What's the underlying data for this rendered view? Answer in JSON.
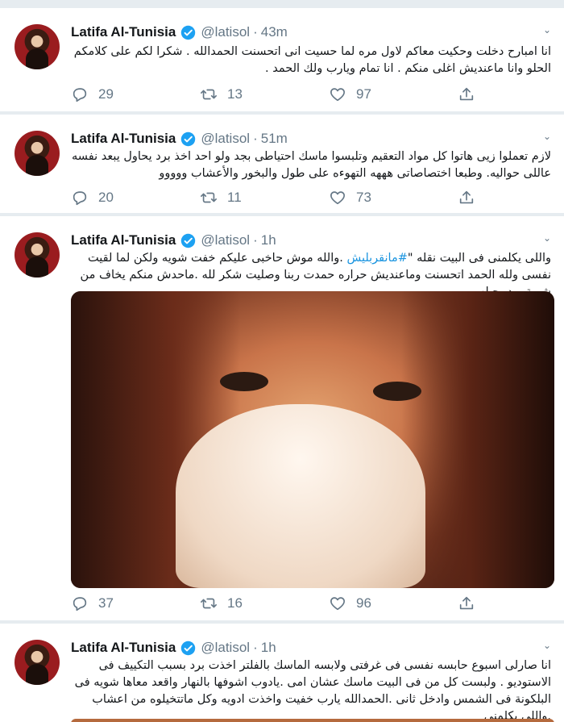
{
  "tweets": [
    {
      "name": "Latifa Al-Tunisia",
      "handle": "@latisol",
      "time": "43m",
      "text": "انا امبارح دخلت وحكيت معاكم لاول مره لما حسيت انى اتحسنت الحمدالله . شكرا لكم على كلامكم الحلو وانا ماعنديش اغلى منكم . انا تمام ويارب ولك الحمد .",
      "replies": "29",
      "retweets": "13",
      "likes": "97"
    },
    {
      "name": "Latifa Al-Tunisia",
      "handle": "@latisol",
      "time": "51m",
      "text": "لازم تعملوا زيى هاتوا كل مواد التعقيم وتلبسوا ماسك احتياطى بجد ولو احد اخذ برد يحاول يبعد نفسه عاللى حواليه. وطبعا اختصاصاتى هههه التهوءه على طول والبخور والأعشاب ووووو",
      "replies": "20",
      "retweets": "11",
      "likes": "73"
    },
    {
      "name": "Latifa Al-Tunisia",
      "handle": "@latisol",
      "time": "1h",
      "text_before": "واللى يكلمنى فى البيت نقله \"",
      "hashtag": "#مانقربليش",
      "text_after": " .والله موش حاخبى عليكم خفت شويه ولكن لما لقيت نفسى ولله الحمد اتحسنت وماعنديش حراره حمدت ربنا وصليت شكر لله .ماحدش منكم يخاف من شوية برد يجيله .",
      "replies": "37",
      "retweets": "16",
      "likes": "96"
    },
    {
      "name": "Latifa Al-Tunisia",
      "handle": "@latisol",
      "time": "1h",
      "text": "انا صارلى اسبوع حابسه نفسى فى غرفتى ولابسه الماسك بالفلتر اخذت برد بسبب التكييف فى الاستوديو . ولبست كل من فى البيت ماسك عشان امى .يادوب اشوفها بالنهار واقعد معاها شويه فى البلكونة فى الشمس وادخل ثانى .الحمدالله يارب خفيت واخذت ادويه وكل ماتتخيلوه من اعشاب .واللى يكلمنى"
    }
  ],
  "colors": {
    "verified": "#1da1f2",
    "hashtag": "#1b95e0",
    "muted": "#657786",
    "divider": "#e6ecf0"
  },
  "icons": [
    "caret-down-icon",
    "verified-badge-icon",
    "reply-icon",
    "retweet-icon",
    "like-icon",
    "share-icon"
  ]
}
